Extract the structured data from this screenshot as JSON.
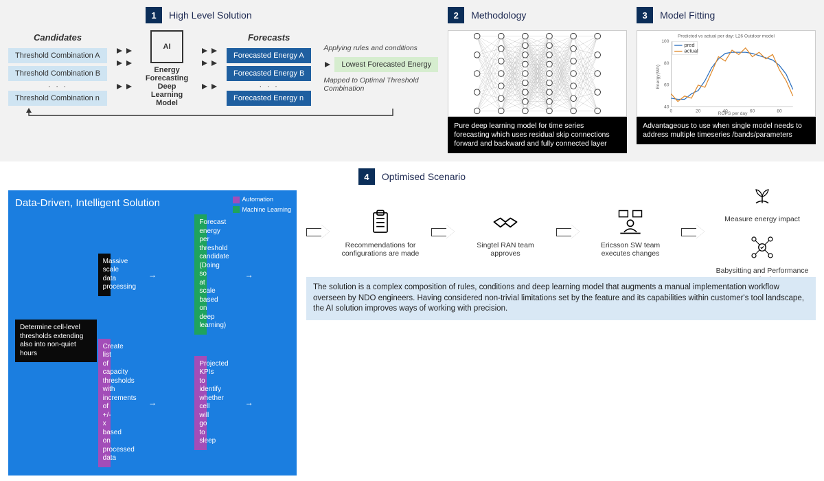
{
  "sections": {
    "s1": {
      "num": "1",
      "title": "High Level Solution"
    },
    "s2": {
      "num": "2",
      "title": "Methodology"
    },
    "s3": {
      "num": "3",
      "title": "Model Fitting"
    },
    "s4": {
      "num": "4",
      "title": "Optimised Scenario"
    }
  },
  "hls": {
    "candidates_label": "Candidates",
    "forecasts_label": "Forecasts",
    "candidates": [
      "Threshold Combination A",
      "Threshold Combination B",
      "Threshold Combination n"
    ],
    "model_label": "Energy Forecasting Deep Learning Model",
    "ai_chip_label": "AI",
    "forecasts": [
      "Forecasted Energy A",
      "Forecasted Energy B",
      "Forecasted Energy n"
    ],
    "rules_note": "Applying rules and conditions",
    "result": "Lowest Forecasted Energy",
    "mapped_note": "Mapped to Optimal Threshold Combination"
  },
  "methodology": {
    "caption": "Pure deep learning model for time series forecasting which uses residual skip connections forward and backward and fully connected layer",
    "layers": [
      5,
      7,
      9,
      9,
      7,
      5
    ]
  },
  "modelfit": {
    "title": "Predicted vs actual per day: L26 Outdoor model",
    "legend_pred": "pred",
    "legend_actual": "actual",
    "xlabel": "ROPS per day",
    "ylabel": "Energy(Wh)",
    "caption": "Advantageous to use when single model needs to address multiple timeseries  /bands/parameters"
  },
  "chart_data": {
    "type": "line",
    "title": "Predicted vs actual per day: L26 Outdoor model",
    "xlabel": "ROPS per day",
    "ylabel": "Energy(Wh)",
    "xlim": [
      0,
      90
    ],
    "ylim": [
      40,
      100
    ],
    "x": [
      0,
      5,
      10,
      15,
      20,
      25,
      30,
      35,
      40,
      45,
      50,
      55,
      60,
      65,
      70,
      75,
      80,
      85,
      90
    ],
    "series": [
      {
        "name": "pred",
        "color": "#2a6fbf",
        "values": [
          48,
          47,
          47,
          52,
          55,
          64,
          76,
          84,
          89,
          90,
          90,
          90,
          89,
          87,
          85,
          83,
          78,
          70,
          56
        ]
      },
      {
        "name": "actual",
        "color": "#e08b2e",
        "values": [
          52,
          45,
          50,
          48,
          60,
          58,
          72,
          86,
          82,
          92,
          88,
          94,
          86,
          90,
          84,
          88,
          74,
          64,
          50
        ]
      }
    ]
  },
  "blue_panel": {
    "title": "Data-Driven, Intelligent Solution",
    "legend_automation": "Automation",
    "legend_ml": "Machine Learning",
    "nodes": {
      "a": "Massive scale data processing",
      "b": "Create list of capacity thresholds with increments of +/- x based on processed data",
      "c": "Forecast energy per threshold candidate (Doing so at scale based on deep learning)",
      "d": "Projected KPIs to identify whether cell will go to sleep",
      "e": "Determine cell-level thresholds extending also into non-quiet hours"
    }
  },
  "workflow": {
    "step1": "Recommendations for configurations are made",
    "step2": "Singtel RAN team approves",
    "step3": "Ericsson SW team executes changes",
    "step4a": "Measure energy impact",
    "step4b": "Babysitting and Performance Monitoring"
  },
  "summary": "The solution is a complex composition of rules, conditions and deep learning model that augments a manual implementation workflow overseen by NDO engineers. Having considered non-trivial limitations set by the feature and its capabilities within customer's tool landscape, the AI solution improves ways of working with precision."
}
